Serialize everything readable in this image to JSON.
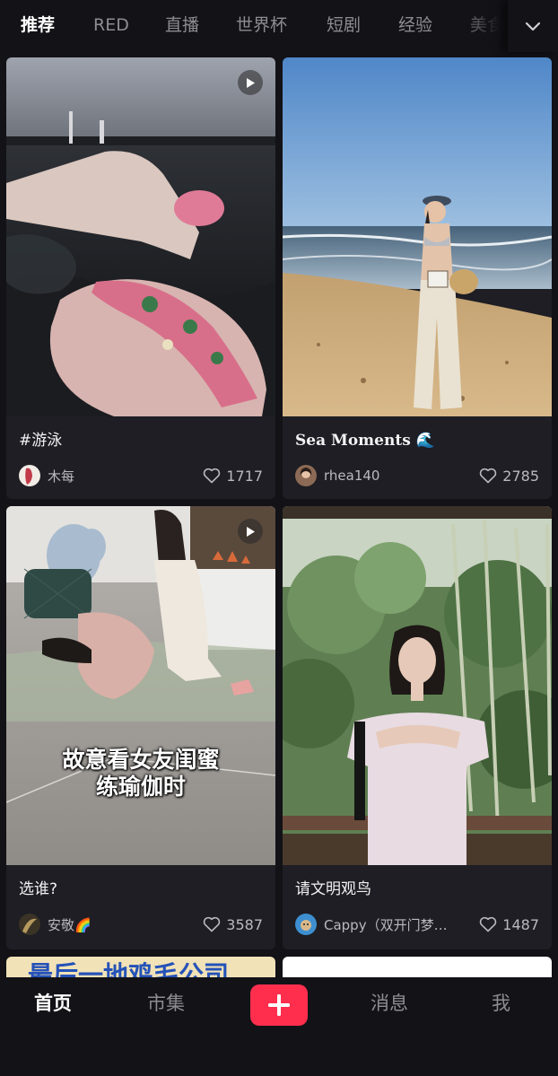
{
  "top_tabs": [
    {
      "label": "推荐",
      "active": true
    },
    {
      "label": "RED",
      "active": false
    },
    {
      "label": "直播",
      "active": false
    },
    {
      "label": "世界杯",
      "active": false
    },
    {
      "label": "短剧",
      "active": false
    },
    {
      "label": "经验",
      "active": false
    },
    {
      "label": "美食",
      "active": false
    }
  ],
  "more_icon": "chevron-down-icon",
  "feed": [
    {
      "title": "#游泳",
      "author": "木每",
      "likes": "1717",
      "is_video": true,
      "image": "swimmer-in-water"
    },
    {
      "title": "Sea Moments 🌊",
      "author": "rhea140",
      "likes": "2785",
      "is_video": false,
      "image": "woman-on-beach"
    },
    {
      "title": "选谁?",
      "author": "安敬🌈",
      "likes": "3587",
      "is_video": true,
      "image": "yoga-room",
      "overlay_caption_line1": "故意看女友闺蜜",
      "overlay_caption_line2": "练瑜伽时"
    },
    {
      "title": "请文明观鸟",
      "author": "Cappy（双开门梦…",
      "likes": "1487",
      "is_video": false,
      "image": "woman-in-bamboo-forest"
    }
  ],
  "partial_cards": [
    {
      "visible_text": "最后一地鸡毛公司"
    },
    {
      "visible_text": ""
    }
  ],
  "bottom_nav": {
    "home": "首页",
    "market": "市集",
    "publish_icon": "plus-icon",
    "messages": "消息",
    "me": "我"
  },
  "colors": {
    "background": "#121217",
    "card": "#1e1e24",
    "accent": "#ff2e4d",
    "text_muted": "#8c8c92"
  }
}
